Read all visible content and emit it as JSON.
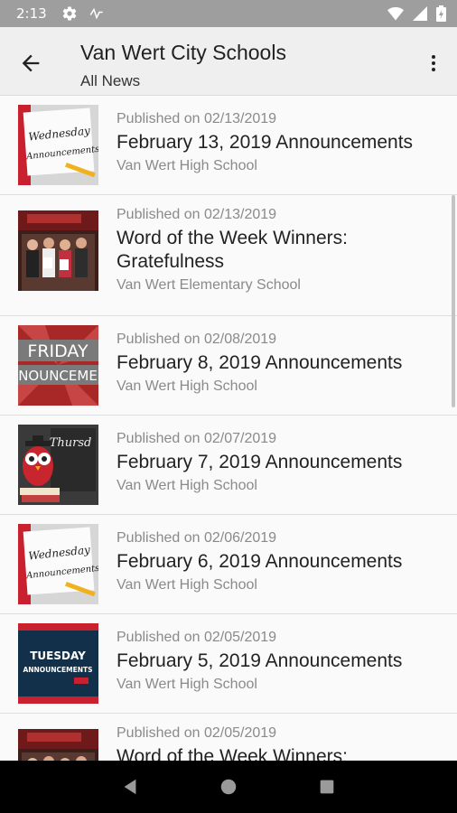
{
  "status_bar": {
    "time": "2:13",
    "icons": [
      "gear-icon",
      "signal-strength-icon",
      "wifi-icon",
      "cellular-icon",
      "battery-icon"
    ]
  },
  "app_bar": {
    "title": "Van Wert City Schools",
    "subtitle": "All News",
    "back_icon": "arrow-left-icon",
    "menu_icon": "more-vert-icon"
  },
  "news": [
    {
      "date": "Published on 02/13/2019",
      "title": "February 13, 2019 Announcements",
      "school": "Van Wert High School",
      "thumb": "wednesday-announcements-thumbnail"
    },
    {
      "date": "Published on 02/13/2019",
      "title": "Word of the Week Winners: Gratefulness",
      "school": "Van Wert Elementary School",
      "thumb": "students-photo-thumbnail"
    },
    {
      "date": "Published on 02/08/2019",
      "title": "February 8, 2019 Announcements",
      "school": "Van Wert High School",
      "thumb": "friday-announcements-thumbnail"
    },
    {
      "date": "Published on 02/07/2019",
      "title": "February 7, 2019 Announcements",
      "school": "Van Wert High School",
      "thumb": "thursday-owl-thumbnail"
    },
    {
      "date": "Published on 02/06/2019",
      "title": "February 6, 2019 Announcements",
      "school": "Van Wert High School",
      "thumb": "wednesday-announcements-thumbnail"
    },
    {
      "date": "Published on 02/05/2019",
      "title": "February 5, 2019 Announcements",
      "school": "Van Wert High School",
      "thumb": "tuesday-announcements-thumbnail"
    },
    {
      "date": "Published on 02/05/2019",
      "title": "Word of the Week Winners:",
      "school": "",
      "thumb": "students-photo-thumbnail"
    }
  ],
  "thumb_text": {
    "wednesday_line1": "Wednesday",
    "wednesday_line2": "Announcements",
    "friday_line1": "FRIDAY",
    "friday_line2": "NNOUNCEMEN",
    "thursday_line1": "Thursd",
    "tuesday_line1": "TUESDAY",
    "tuesday_line2": "ANNOUNCEMENTS"
  },
  "nav_bar": {
    "icons": [
      "back-triangle-icon",
      "home-circle-icon",
      "recents-square-icon"
    ]
  },
  "colors": {
    "status_bar": "#9e9e9e",
    "app_bar": "#efefef",
    "text_primary": "#222222",
    "text_secondary": "#8a8a8a"
  }
}
